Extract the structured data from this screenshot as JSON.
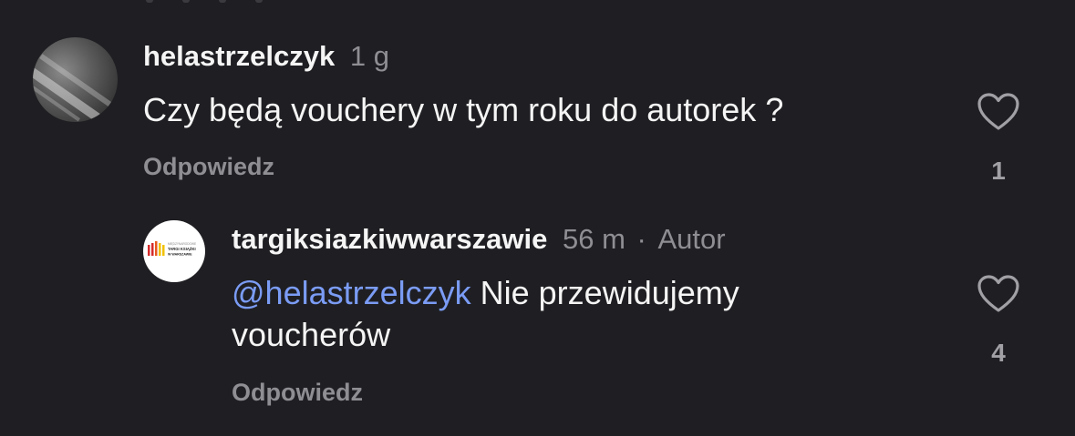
{
  "comments": [
    {
      "username": "helastrzelczyk",
      "time": "1 g",
      "text": "Czy będą vouchery w tym roku do autorek ?",
      "reply_label": "Odpowiedz",
      "likes": "1",
      "avatar_icon": "user-photo-avatar"
    }
  ],
  "replies": [
    {
      "username": "targiksiazkiwwarszawie",
      "time": "56 m",
      "separator": "·",
      "badge": "Autor",
      "mention": "@helastrzelczyk",
      "text_line1": "Nie przewidujemy",
      "text_line2": "voucherów",
      "reply_label": "Odpowiedz",
      "likes": "4",
      "logo_text": {
        "line1": "MIĘDZYNARODOWE",
        "line2": "TARGI KSIĄŻKI",
        "line3": "W WARSZAWIE"
      }
    }
  ],
  "colors": {
    "background": "#1f1f23",
    "text": "#f5f5f5",
    "secondary": "#8e8e93",
    "mention": "#7b9cf5",
    "logo_red": "#d62b2b",
    "logo_yellow": "#f2c200"
  },
  "icons": [
    "heart-icon"
  ]
}
